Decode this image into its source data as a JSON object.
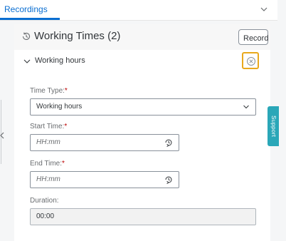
{
  "tabs": {
    "active_label": "Recordings"
  },
  "card": {
    "title": "Working Times (2)",
    "record_label": "Record"
  },
  "section": {
    "title": "Working hours"
  },
  "form": {
    "time_type_label": "Time Type:",
    "time_type_value": "Working hours",
    "start_label": "Start Time:",
    "start_placeholder": "HH:mm",
    "end_label": "End Time:",
    "end_placeholder": "HH:mm",
    "duration_label": "Duration:",
    "duration_value": "00:00",
    "required_mark": "*"
  },
  "side": {
    "support_label": "Support"
  },
  "colors": {
    "accent": "#0a6ed1",
    "focus_highlight": "#e9a81c",
    "support_tab": "#2aa7b8",
    "required": "#bb0000"
  },
  "icons": [
    "chevron-down-icon",
    "history-icon",
    "chevron-down-icon",
    "close-circle-icon",
    "time-icon",
    "chevron-left-icon"
  ]
}
